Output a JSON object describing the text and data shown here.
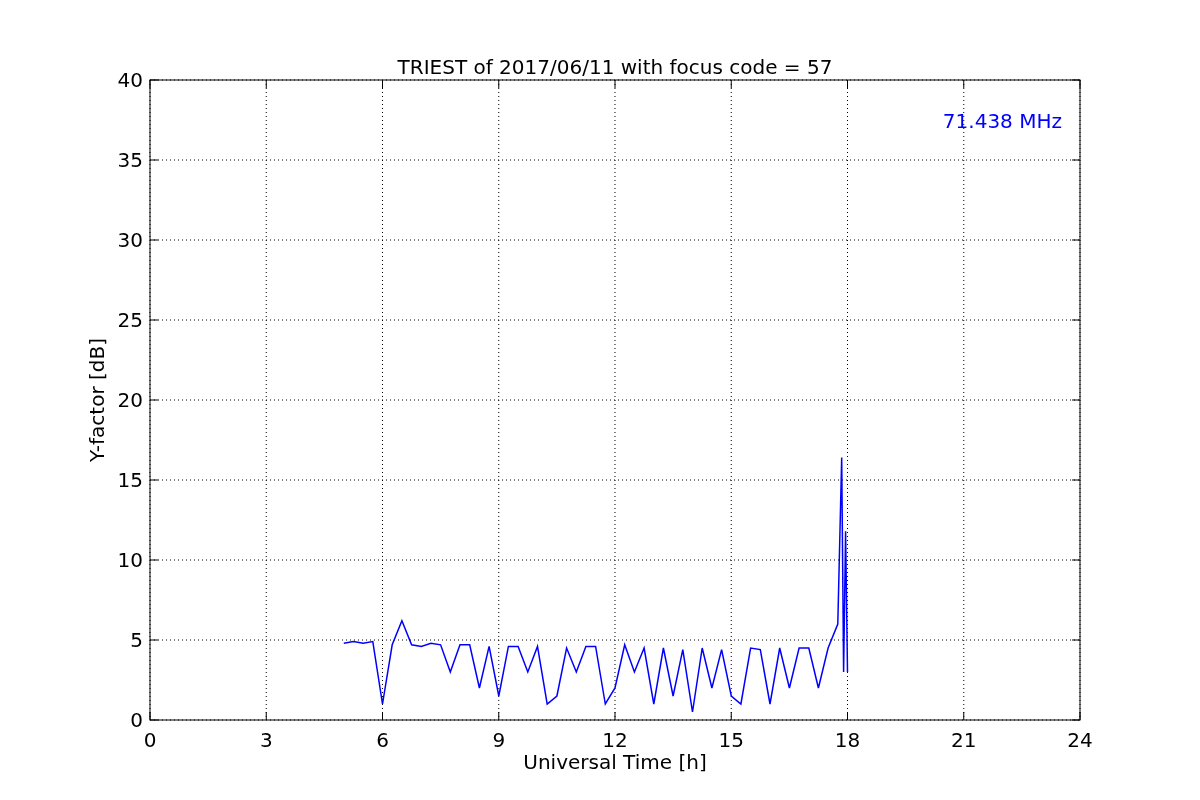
{
  "chart_data": {
    "type": "line",
    "title": "TRIEST of 2017/06/11 with focus code = 57",
    "xlabel": "Universal Time [h]",
    "ylabel": "Y-factor [dB]",
    "x": [
      5,
      5.25,
      5.5,
      5.75,
      6,
      6.25,
      6.5,
      6.75,
      7,
      7.25,
      7.5,
      7.75,
      8,
      8.25,
      8.5,
      8.75,
      9,
      9.25,
      9.5,
      9.75,
      10,
      10.25,
      10.5,
      10.75,
      11,
      11.25,
      11.5,
      11.75,
      12,
      12.25,
      12.5,
      12.75,
      13,
      13.25,
      13.5,
      13.75,
      14,
      14.25,
      14.5,
      14.75,
      15,
      15.25,
      15.5,
      15.75,
      16,
      16.25,
      16.5,
      16.75,
      17,
      17.25,
      17.5,
      17.75,
      17.85,
      17.9,
      17.95,
      18
    ],
    "series": [
      {
        "name": "71.438 MHz",
        "color": "#0000ff",
        "values": [
          4.8,
          4.9,
          4.8,
          4.9,
          1.0,
          4.7,
          6.2,
          4.7,
          4.6,
          4.8,
          4.7,
          3.0,
          4.7,
          4.7,
          2.0,
          4.6,
          1.5,
          4.6,
          4.6,
          3.0,
          4.6,
          1.0,
          1.5,
          4.5,
          3.0,
          4.6,
          4.6,
          1.0,
          2.0,
          4.7,
          3.0,
          4.5,
          1.0,
          4.5,
          1.5,
          4.4,
          0.5,
          4.5,
          2.0,
          4.4,
          1.5,
          1.0,
          4.5,
          4.4,
          1.0,
          4.5,
          2.0,
          4.5,
          4.5,
          2.0,
          4.5,
          6.0,
          16.4,
          3.0,
          11.8,
          3.0
        ]
      }
    ],
    "xlim": [
      0,
      24
    ],
    "ylim": [
      0,
      40
    ],
    "xticks": [
      0,
      3,
      6,
      9,
      12,
      15,
      18,
      21,
      24
    ],
    "yticks": [
      0,
      5,
      10,
      15,
      20,
      25,
      30,
      35,
      40
    ],
    "grid": true
  }
}
